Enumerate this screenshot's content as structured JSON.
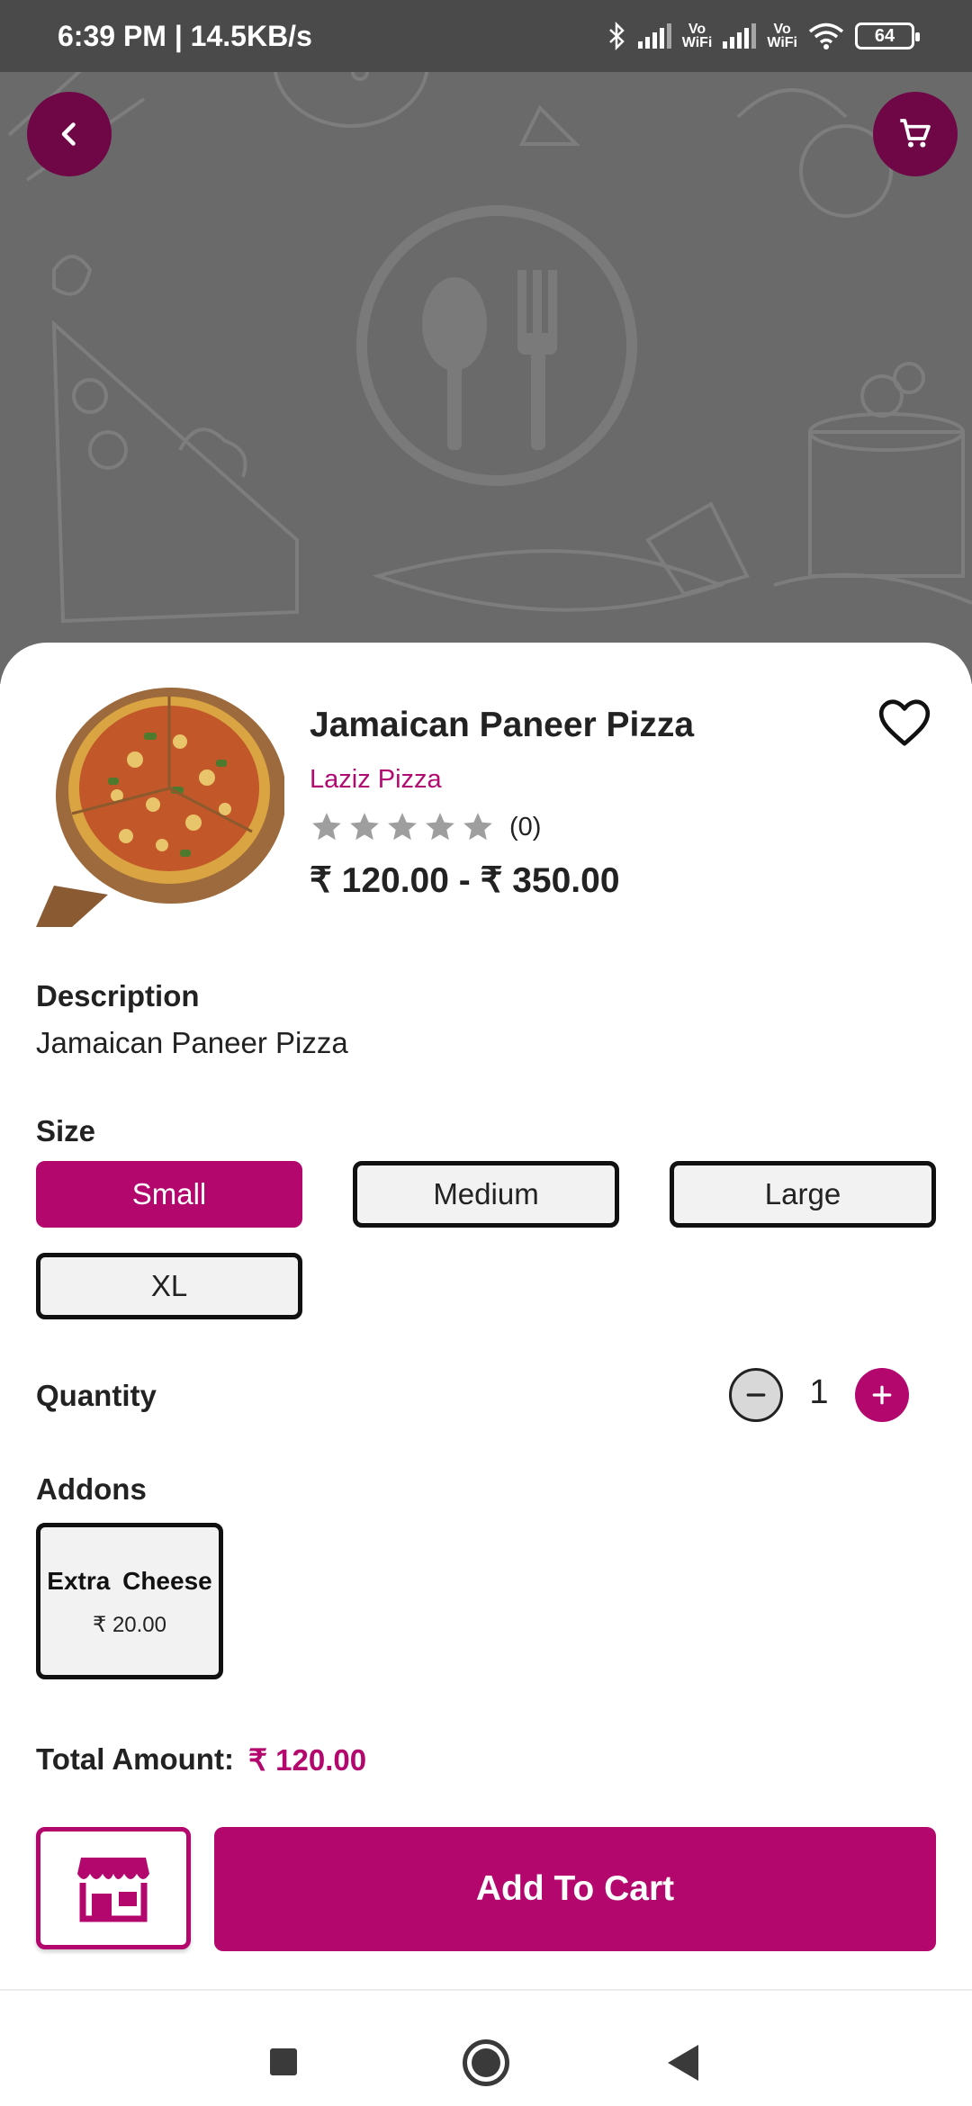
{
  "status_bar": {
    "time_speed": "6:39 PM | 14.5KB/s",
    "vowifi_top": "Vo",
    "vowifi_bottom": "WiFi",
    "battery": "64"
  },
  "hero": {
    "back_icon": "chevron-left-icon",
    "cart_icon": "shopping-cart-icon",
    "accent": "#6f0747"
  },
  "product": {
    "name": "Jamaican Paneer Pizza",
    "store": "Laziz Pizza",
    "rating_stars": 0,
    "rating_count": "(0)",
    "price_range": "₹ 120.00 - ₹ 350.00",
    "favorite_icon": "heart-outline-icon"
  },
  "description": {
    "label": "Description",
    "text": "Jamaican Paneer Pizza"
  },
  "size": {
    "label": "Size",
    "options": [
      "Small",
      "Medium",
      "Large",
      "XL"
    ],
    "selected": "Small"
  },
  "quantity": {
    "label": "Quantity",
    "value": "1"
  },
  "addons": {
    "label": "Addons",
    "items": [
      {
        "name": "Extra  Cheese",
        "price": "₹ 20.00"
      }
    ]
  },
  "total": {
    "label": "Total Amount:",
    "value": "₹ 120.00"
  },
  "actions": {
    "store_icon": "storefront-icon",
    "add_to_cart": "Add To Cart"
  },
  "colors": {
    "brand": "#b3076e",
    "hero_bg": "#6a6a6a"
  }
}
